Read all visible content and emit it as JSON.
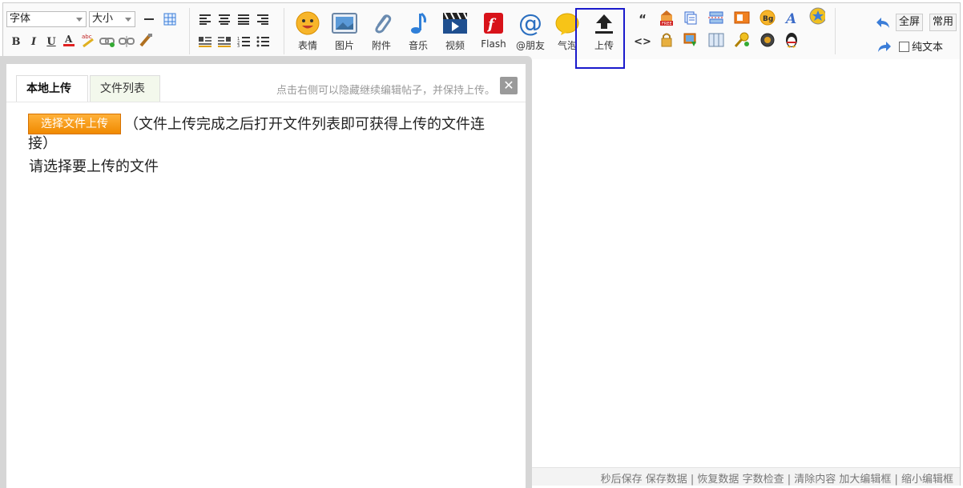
{
  "toolbar": {
    "font_select": "字体",
    "size_select": "大小",
    "big_buttons": [
      {
        "label": "表情"
      },
      {
        "label": "图片"
      },
      {
        "label": "附件"
      },
      {
        "label": "音乐"
      },
      {
        "label": "视频"
      },
      {
        "label": "Flash"
      },
      {
        "label": "@朋友"
      },
      {
        "label": "气泡"
      },
      {
        "label": "上传"
      }
    ],
    "fullscreen": "全屏",
    "common": "常用",
    "plaintext": "纯文本"
  },
  "popup": {
    "tab_local": "本地上传",
    "tab_list": "文件列表",
    "hint": "点击右侧可以隐藏继续编辑帖子，并保持上传。",
    "close": "✕",
    "upload_button": "选择文件上传",
    "description": "（文件上传完成之后打开文件列表即可获得上传的文件连接）",
    "choose_prompt": "请选择要上传的文件"
  },
  "statusbar": {
    "text": "秒后保存 保存数据 | 恢复数据   字数检查 | 清除内容   加大编辑框 | 缩小编辑框"
  }
}
